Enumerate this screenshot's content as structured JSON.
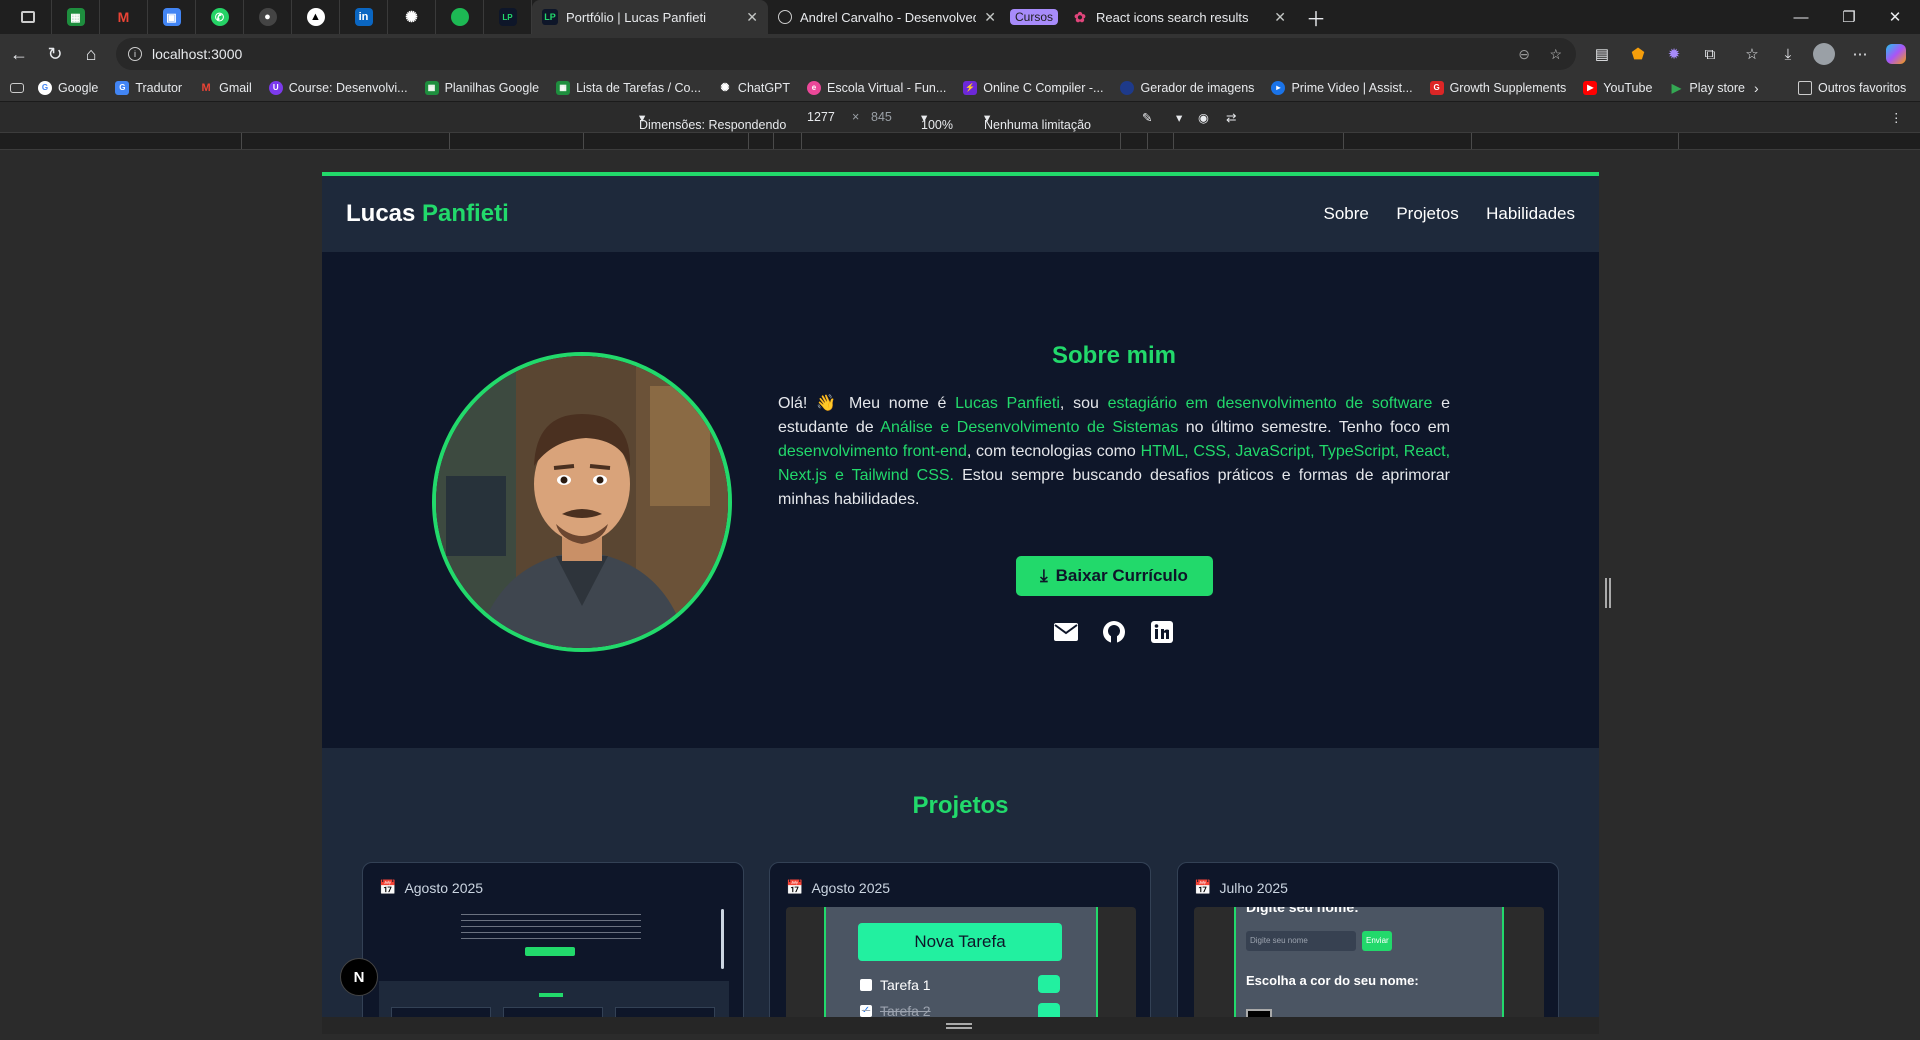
{
  "browser": {
    "pinned_tabs": [
      {
        "icon": "tab-list-icon"
      },
      {
        "icon": "sheets-icon"
      },
      {
        "icon": "gmail-icon"
      },
      {
        "icon": "photos-icon"
      },
      {
        "icon": "whatsapp-icon"
      },
      {
        "icon": "github-icon"
      },
      {
        "icon": "notion-icon"
      },
      {
        "icon": "linkedin-icon"
      },
      {
        "icon": "chatgpt-icon"
      },
      {
        "icon": "spotify-icon"
      },
      {
        "icon": "portfolio-icon"
      }
    ],
    "tabs": [
      {
        "title": "Portfólio | Lucas Panfieti",
        "active": true
      },
      {
        "title": "Andrel Carvalho - Desenvolvedor",
        "active": false
      },
      {
        "title": "React icons search results",
        "group_label": "Cursos",
        "active": false
      }
    ],
    "url": "localhost:3000",
    "bookmarks": [
      "Google",
      "Tradutor",
      "Gmail",
      "Course: Desenvolvi...",
      "Planilhas Google",
      "Lista de Tarefas / Co...",
      "ChatGPT",
      "Escola Virtual - Fun...",
      "Online C Compiler -...",
      "Gerador de imagens",
      "Prime Video | Assist...",
      "Growth Supplements",
      "YouTube",
      "Play store"
    ],
    "other_bookmarks": "Outros favoritos",
    "accent": "#a78bfa"
  },
  "devtools": {
    "dimensions_label": "Dimensões: Respondendo",
    "width": "1277",
    "times": "×",
    "height": "845",
    "zoom": "100%",
    "throttle": "Nenhuma limitação"
  },
  "site": {
    "brand_first": "Lucas",
    "brand_second": "Panfieti",
    "nav": [
      "Sobre",
      "Projetos",
      "Habilidades"
    ],
    "about": {
      "title": "Sobre mim",
      "parts": [
        {
          "t": "Olá! 👋 Meu nome é ",
          "g": false
        },
        {
          "t": "Lucas Panfieti",
          "g": true
        },
        {
          "t": ", sou ",
          "g": false
        },
        {
          "t": "estagiário em desenvolvimento de software",
          "g": true
        },
        {
          "t": " e estudante de ",
          "g": false
        },
        {
          "t": "Análise e Desenvolvimento de Sistemas",
          "g": true
        },
        {
          "t": " no último semestre. Tenho foco em ",
          "g": false
        },
        {
          "t": "desenvolvimento front-end",
          "g": true
        },
        {
          "t": ", com tecnologias como ",
          "g": false
        },
        {
          "t": "HTML, CSS, JavaScript, TypeScript, React, Next.js e Tailwind CSS.",
          "g": true
        },
        {
          "t": " Estou sempre buscando desafios práticos e formas de aprimorar minhas habilidades.",
          "g": false
        }
      ],
      "cv_button": "Baixar Currículo"
    },
    "projects": {
      "title": "Projetos",
      "cards": [
        {
          "date": "Agosto 2025"
        },
        {
          "date": "Agosto 2025",
          "preview_title": "Nova Tarefa",
          "items": [
            "Tarefa 1",
            "Tarefa 2"
          ]
        },
        {
          "date": "Julho 2025",
          "preview_heading": "Digite seu nome:",
          "placeholder": "Digite seu nome",
          "send": "Enviar",
          "color_label": "Escolha a cor do seu nome:"
        }
      ]
    },
    "green": "#22d96b"
  }
}
